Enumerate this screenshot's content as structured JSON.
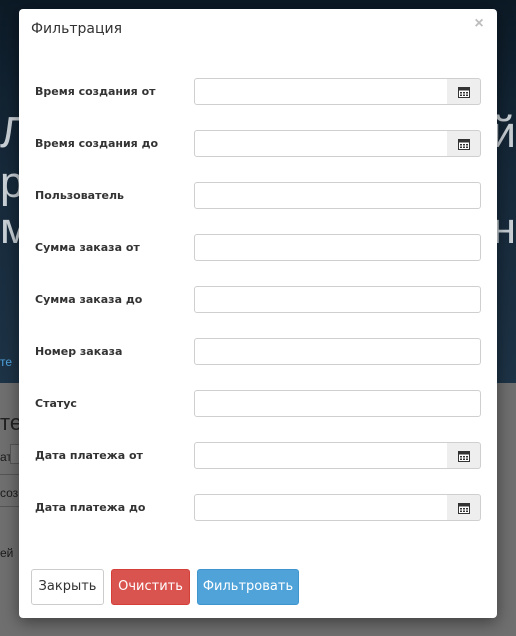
{
  "modal": {
    "title": "Фильтрация",
    "close_icon": "close-icon",
    "fields": [
      {
        "label": "Время создания от",
        "value": "",
        "calendar": true
      },
      {
        "label": "Время создания до",
        "value": "",
        "calendar": true
      },
      {
        "label": "Пользователь",
        "value": "",
        "calendar": false
      },
      {
        "label": "Сумма заказа от",
        "value": "",
        "calendar": false
      },
      {
        "label": "Сумма заказа до",
        "value": "",
        "calendar": false
      },
      {
        "label": "Номер заказа",
        "value": "",
        "calendar": false
      },
      {
        "label": "Статус",
        "value": "",
        "calendar": false
      },
      {
        "label": "Дата платежа от",
        "value": "",
        "calendar": true
      },
      {
        "label": "Дата платежа до",
        "value": "",
        "calendar": true
      }
    ],
    "buttons": {
      "close": "Закрыть",
      "clear": "Очистить",
      "filter": "Фильтровать"
    },
    "colors": {
      "clear": "#d9534f",
      "filter": "#4fa3d9"
    }
  },
  "background": {
    "hero_line_1": "Ле",
    "hero_line_2": "ро",
    "hero_line_3": "ма",
    "hero_right_1": "й",
    "hero_right_3": "н",
    "hero_link": "те",
    "lower_heading": "тех",
    "lower_text_1": "ать",
    "lower_text_2": "соз",
    "lower_text_3": "ей"
  }
}
